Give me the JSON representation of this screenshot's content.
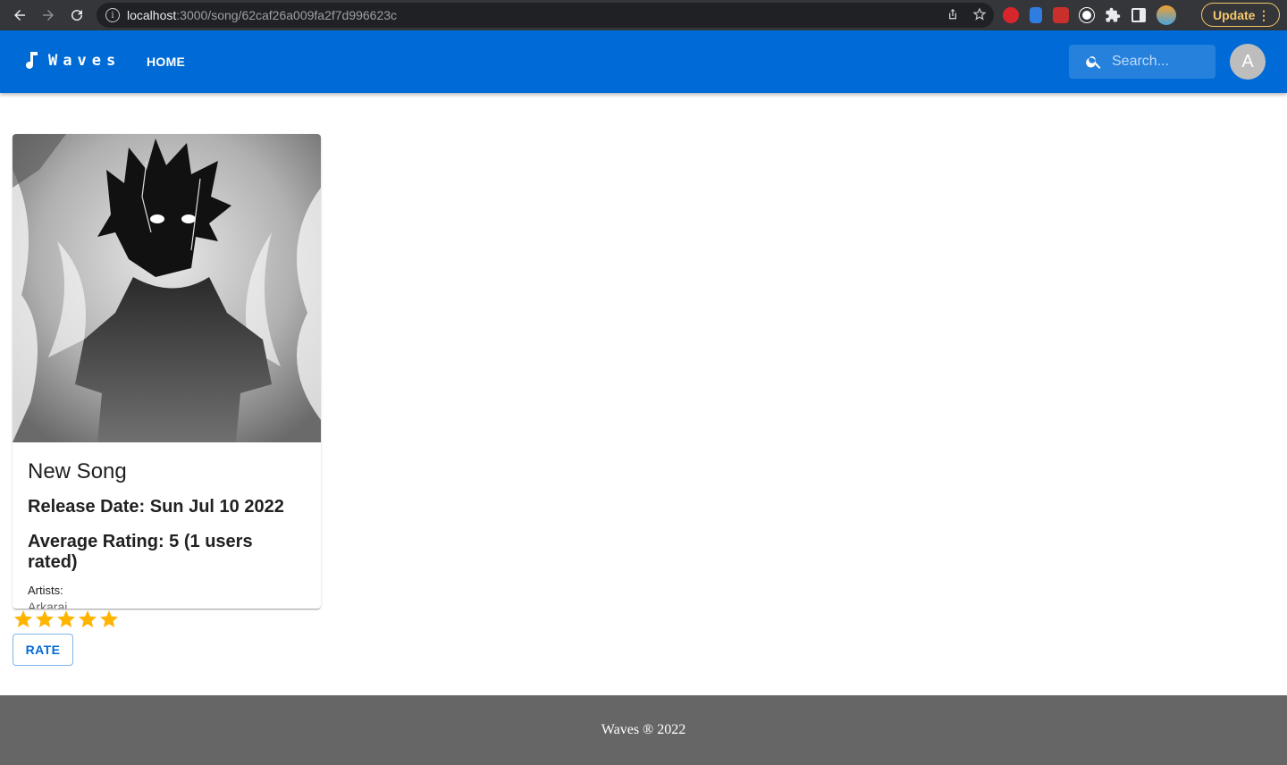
{
  "browser": {
    "url_host": "localhost",
    "url_path": ":3000/song/62caf26a009fa2f7d996623c",
    "update_label": "Update"
  },
  "appbar": {
    "brand": "Waves",
    "home_label": "HOME",
    "search_placeholder": "Search...",
    "avatar_initial": "A",
    "color": "#006bd6"
  },
  "song": {
    "title": "New Song",
    "release_date": "Release Date: Sun Jul 10 2022",
    "average_rating": "Average Rating: 5 (1 users rated)",
    "artists_label": "Artists:",
    "artist": "Arkaraj"
  },
  "rating": {
    "stars": 5,
    "max": 5,
    "star_color": "#ffb400",
    "rate_label": "RATE"
  },
  "footer": {
    "text": "Waves ® 2022"
  }
}
